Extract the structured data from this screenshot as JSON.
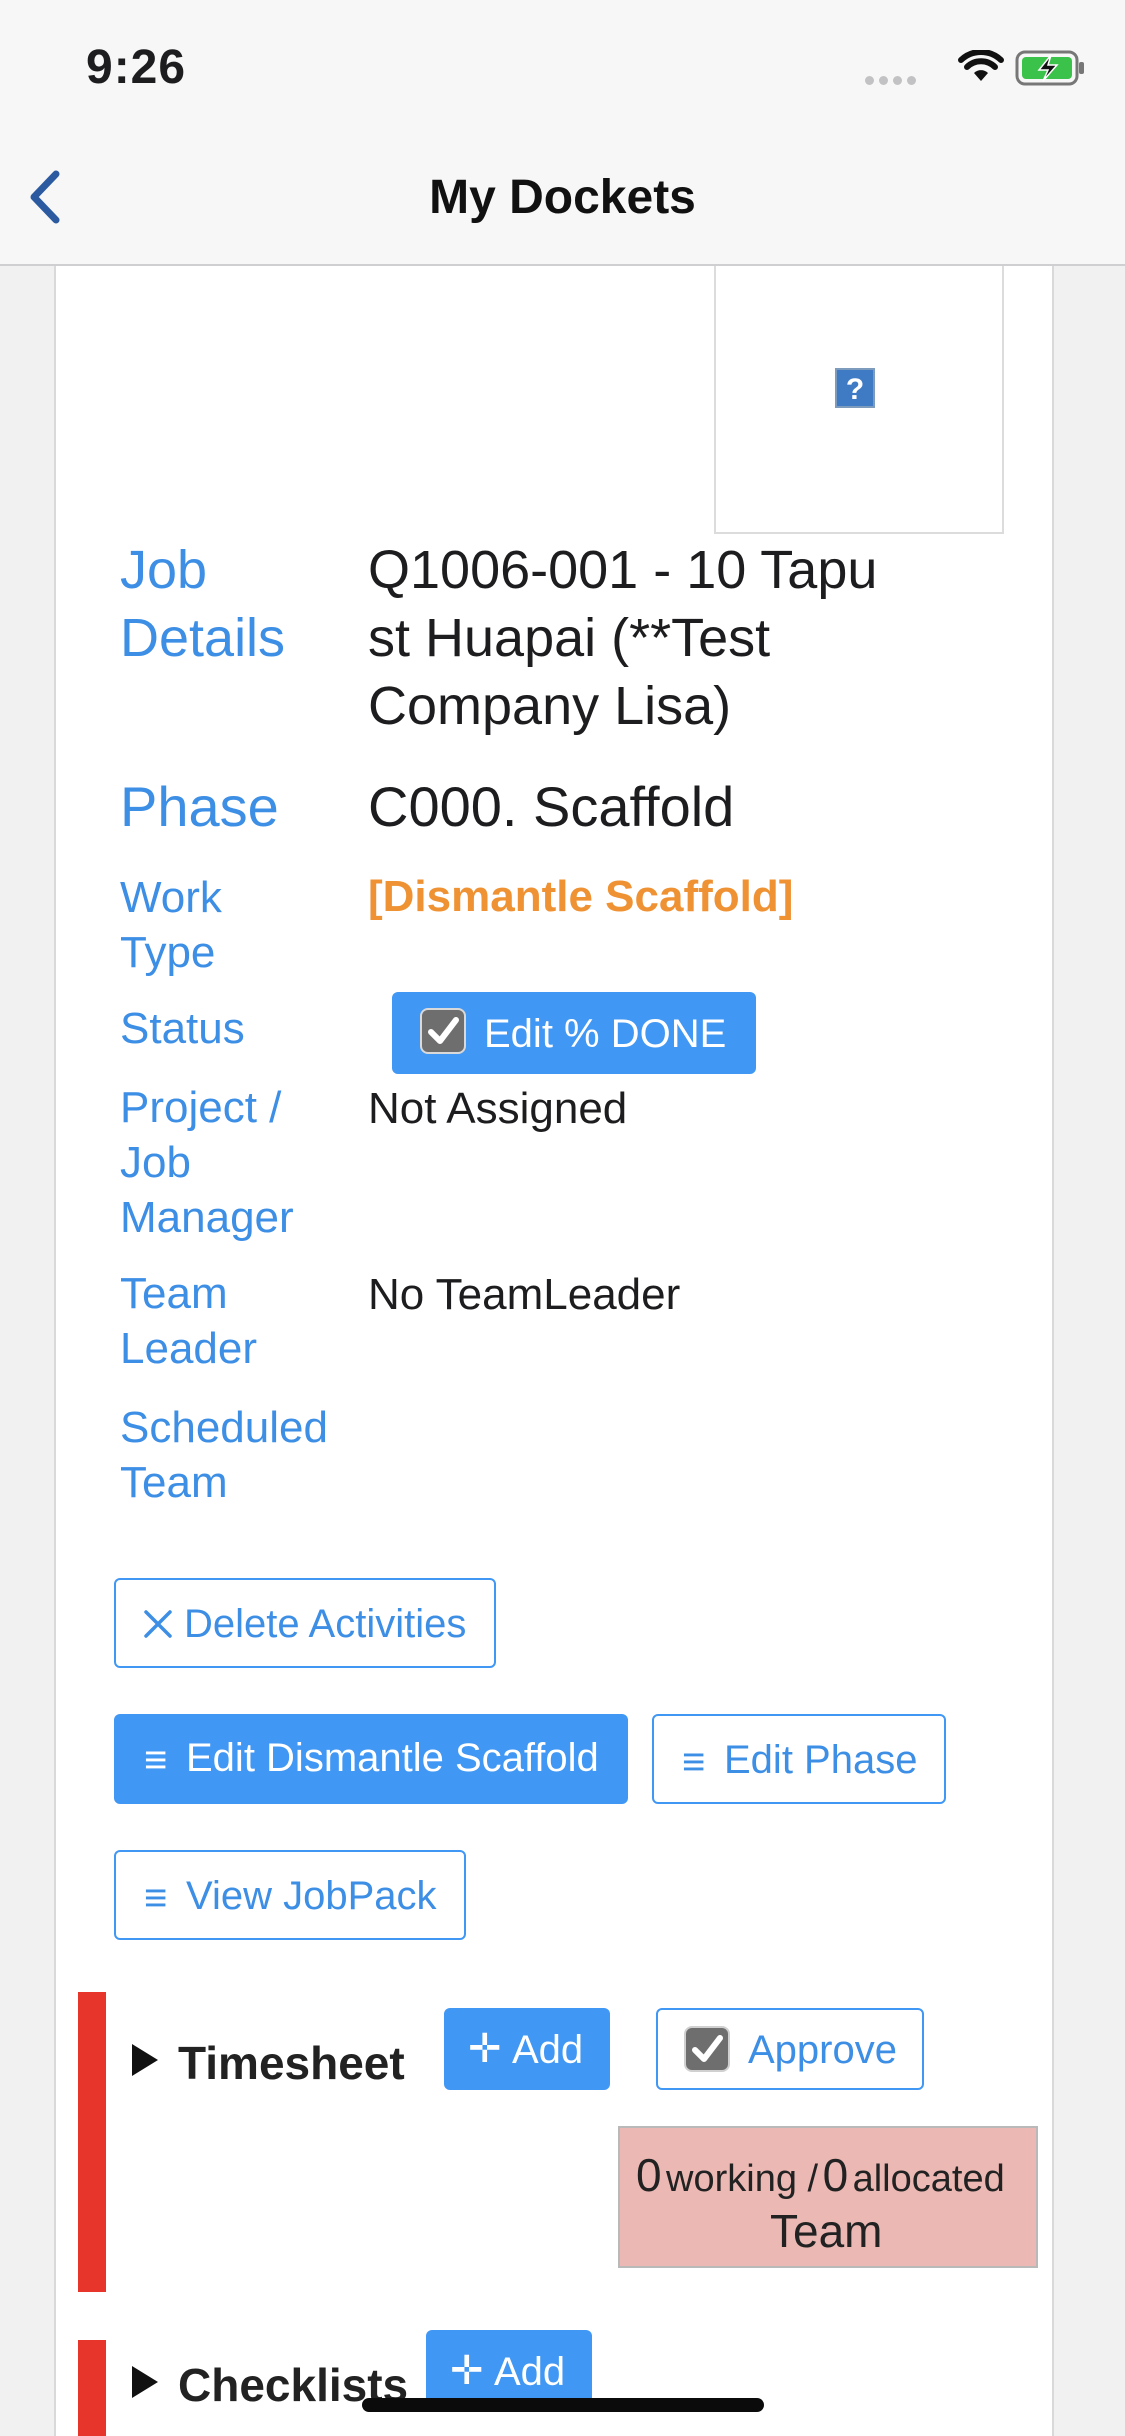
{
  "status_bar": {
    "time": "9:26"
  },
  "nav": {
    "title": "My Dockets"
  },
  "details": {
    "job_label": "Job Details",
    "job_value_lines": [
      "Q1006-001 - 10 Tapu",
      "st Huapai (**Test",
      "Company Lisa)"
    ],
    "phase_label": "Phase",
    "phase_value": "C000. Scaffold",
    "work_type_label_lines": [
      "Work",
      "Type"
    ],
    "work_type_value": "[Dismantle Scaffold]",
    "status_label": "Status",
    "status_button": "Edit % DONE",
    "manager_label_lines": [
      "Project /",
      "Job",
      "Manager"
    ],
    "manager_value": "Not Assigned",
    "leader_label_lines": [
      "Team",
      "Leader"
    ],
    "leader_value": "No TeamLeader",
    "scheduled_label_lines": [
      "Scheduled",
      "Team"
    ]
  },
  "actions": {
    "delete": "Delete Activities",
    "edit_work": "Edit Dismantle Scaffold",
    "edit_phase": "Edit Phase",
    "view_jobpack": "View JobPack"
  },
  "timesheet": {
    "title": "Timesheet",
    "add": "Add",
    "approve": "Approve",
    "working_count": "0",
    "working_text": "working /",
    "allocated_count": "0",
    "allocated_text": "allocated",
    "team_label": "Team"
  },
  "checklists": {
    "title": "Checklists",
    "add": "Add"
  },
  "colors": {
    "accent": "#4197f4",
    "label_blue": "#3d8ee5",
    "work_type_orange": "#ef9234",
    "section_red": "#e7352b",
    "team_box": "#ebb8b4"
  }
}
